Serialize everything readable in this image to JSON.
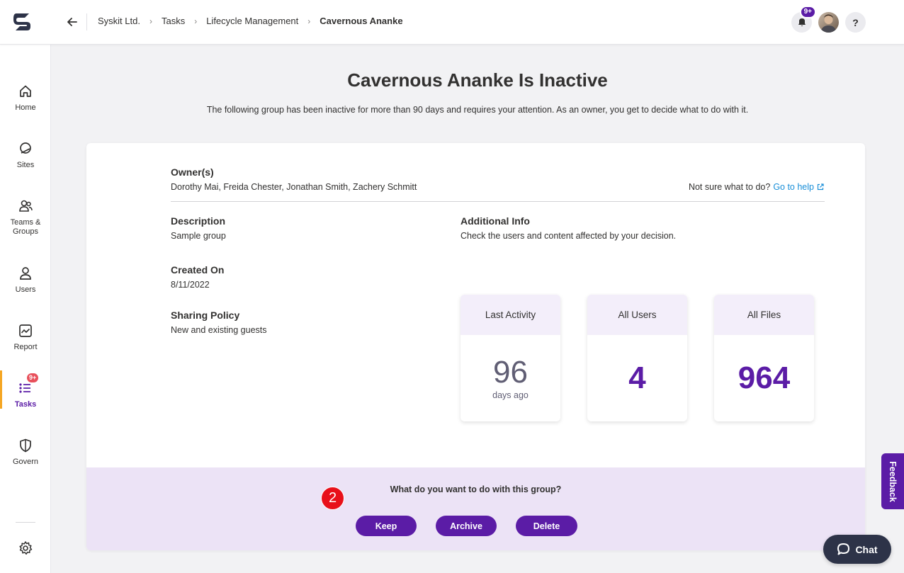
{
  "header": {
    "breadcrumb": [
      "Syskit Ltd.",
      "Tasks",
      "Lifecycle Management",
      "Cavernous Ananke"
    ],
    "notification_badge": "9+",
    "help_label": "?"
  },
  "sidebar": {
    "items": [
      {
        "label": "Home",
        "icon": "home-icon"
      },
      {
        "label": "Sites",
        "icon": "sites-icon"
      },
      {
        "label": "Teams & Groups",
        "icon": "teams-groups-icon"
      },
      {
        "label": "Users",
        "icon": "user-icon"
      },
      {
        "label": "Report",
        "icon": "report-icon"
      },
      {
        "label": "Tasks",
        "icon": "tasks-icon",
        "badge": "9+",
        "active": true
      },
      {
        "label": "Govern",
        "icon": "shield-icon"
      }
    ]
  },
  "page": {
    "title_name": "Cavernous Ananke",
    "title_suffix": "Is Inactive",
    "subtitle": "The following group has been inactive for more than 90 days and requires your attention. As an owner, you get to decide what to do with it."
  },
  "details": {
    "owners_label": "Owner(s)",
    "owners_value": "Dorothy Mai, Freida Chester, Jonathan Smith, Zachery Schmitt",
    "help_text": "Not sure what to do?",
    "help_link": "Go to help",
    "description_label": "Description",
    "description_value": "Sample group",
    "created_label": "Created On",
    "created_value": "8/11/2022",
    "sharing_label": "Sharing Policy",
    "sharing_value": "New and existing guests",
    "additional_label": "Additional Info",
    "additional_value": "Check the users and content affected by your decision."
  },
  "stats": [
    {
      "label": "Last Activity",
      "value": "96",
      "unit": "days ago"
    },
    {
      "label": "All Users",
      "value": "4"
    },
    {
      "label": "All Files",
      "value": "964"
    }
  ],
  "actions": {
    "question": "What do you want to do with this group?",
    "step_marker": "2",
    "keep": "Keep",
    "archive": "Archive",
    "delete": "Delete"
  },
  "feedback_label": "Feedback",
  "chat_label": "Chat",
  "colors": {
    "accent": "#5b1ca6",
    "active_indicator": "#f5a623",
    "action_bg": "#ece3f6",
    "stat_header_bg": "#f3eefa",
    "link": "#1a8fd8",
    "marker": "#e8101a"
  }
}
